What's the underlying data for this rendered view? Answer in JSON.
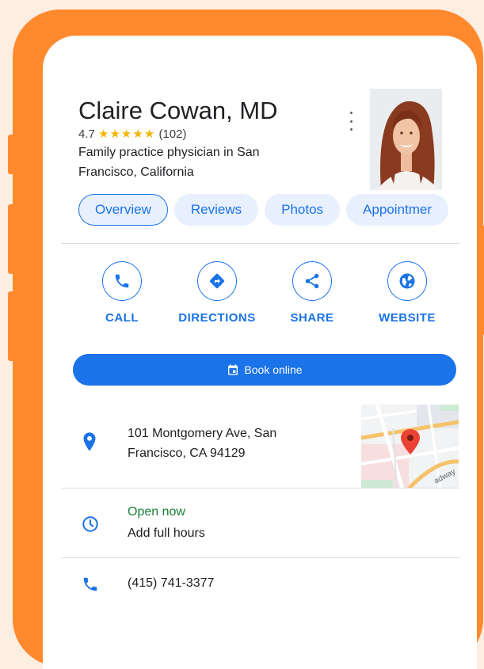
{
  "doctor": {
    "name": "Claire Cowan, MD",
    "rating": "4.7",
    "stars": "★★★★★",
    "review_count": "(102)",
    "description": "Family practice physician in San Francisco, California"
  },
  "tabs": [
    {
      "label": "Overview"
    },
    {
      "label": "Reviews"
    },
    {
      "label": "Photos"
    },
    {
      "label": "Appointmer"
    }
  ],
  "actions": {
    "call": "CALL",
    "directions": "DIRECTIONS",
    "share": "SHARE",
    "website": "WEBSITE"
  },
  "book_button": "Book online",
  "address": "101 Montgomery Ave, San Francisco, CA 94129",
  "map_street_label": "adway",
  "hours": {
    "status": "Open now",
    "action": "Add full hours"
  },
  "phone": "(415) 741-3377",
  "colors": {
    "accent": "#1a73e8",
    "frame": "#ff8a2e",
    "background": "#fdeee2",
    "open": "#188038",
    "pin": "#ea4335",
    "stars": "#f4b400"
  }
}
